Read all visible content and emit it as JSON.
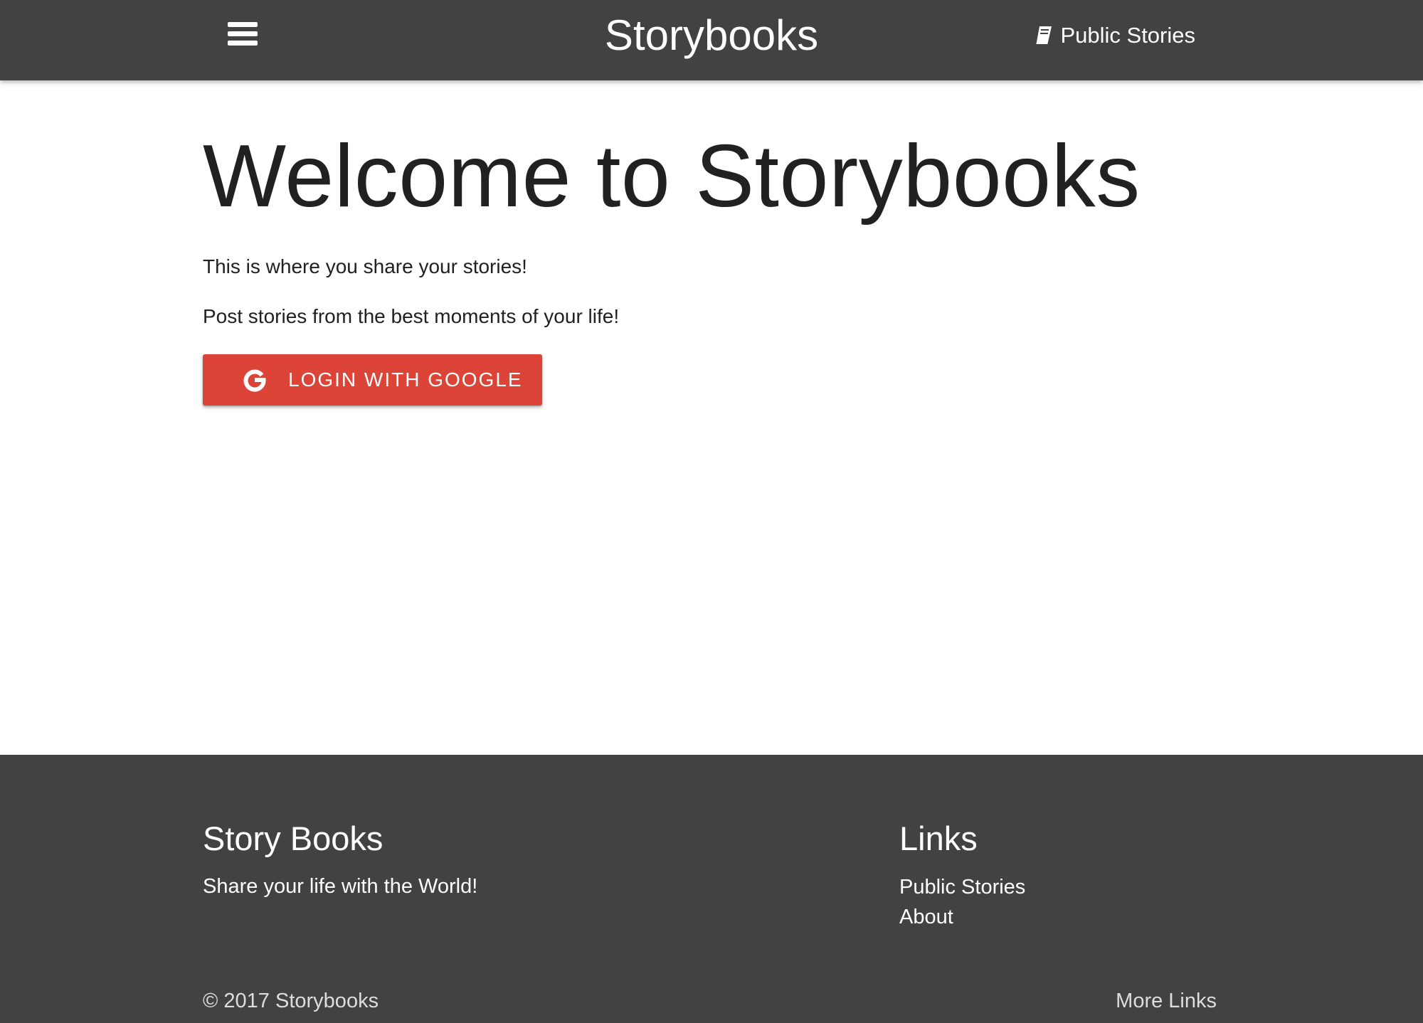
{
  "navbar": {
    "brand": "Storybooks",
    "menu_icon": "hamburger-menu-icon",
    "public_stories_icon": "book-icon",
    "public_stories_label": "Public Stories",
    "background_color": "#424242"
  },
  "main": {
    "title": "Welcome to Storybooks",
    "lead_1": "This is where you share your stories!",
    "lead_2": "Post stories from the best moments of your life!",
    "login_button": {
      "icon": "google-icon",
      "label": "LOGIN WITH GOOGLE",
      "color": "#db4437"
    }
  },
  "footer": {
    "left_title": "Story Books",
    "tagline": "Share your life with the World!",
    "right_title": "Links",
    "links": [
      "Public Stories",
      "About"
    ],
    "copyright": "© 2017 Storybooks",
    "more_links": "More Links",
    "background_color": "#424242"
  }
}
